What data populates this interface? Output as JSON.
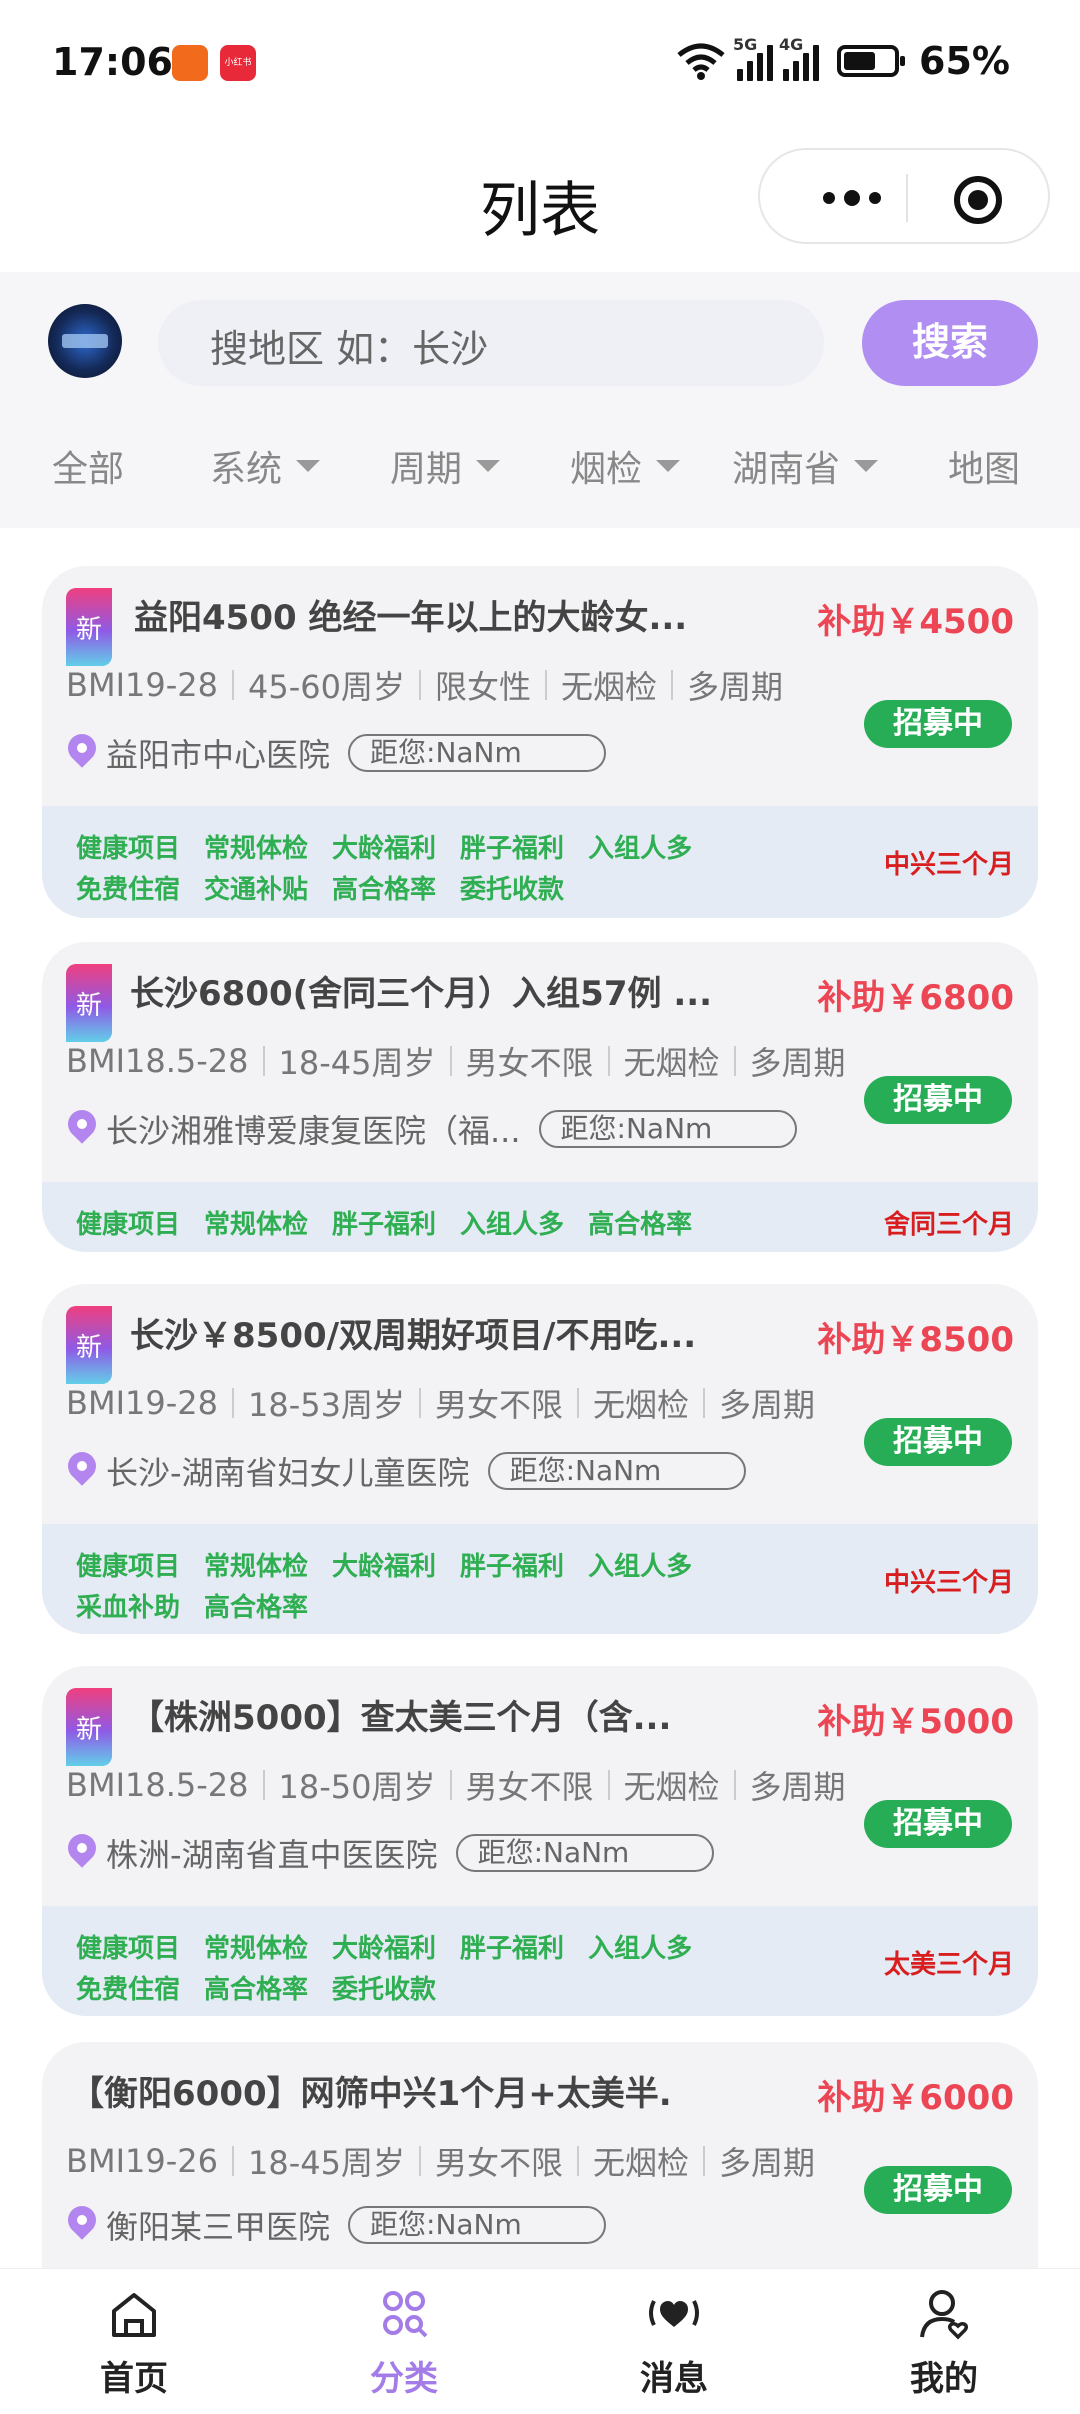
{
  "status": {
    "time": "17:06",
    "battery": "65%",
    "battery_level": 0.65,
    "sig1": "5G",
    "sig2": "4G",
    "mini_app": "小红书"
  },
  "nav": {
    "title": "列表"
  },
  "search": {
    "placeholder": "搜地区 如：长沙",
    "button": "搜索"
  },
  "tabs": [
    {
      "label": "全部"
    },
    {
      "label": "系统"
    },
    {
      "label": "周期"
    },
    {
      "label": "烟检"
    },
    {
      "label": "湖南省"
    },
    {
      "label": "地图"
    }
  ],
  "cards": [
    {
      "new": "新",
      "title": "益阳4500 绝经一年以上的大龄女...",
      "subsidy": "补助￥4500",
      "meta": [
        "BMI19-28",
        "45-60周岁",
        "限女性",
        "无烟检",
        "多周期"
      ],
      "status": "招募中",
      "location": "益阳市中心医院",
      "distance": "距您:NaNm",
      "tags": [
        "健康项目",
        "常规体检",
        "大龄福利",
        "胖子福利",
        "入组人多",
        "免费住宿",
        "交通补贴",
        "高合格率",
        "委托收款"
      ],
      "right_tag": "中兴三个月"
    },
    {
      "new": "新",
      "title": "长沙6800(舍同三个月）入组57例 ...",
      "subsidy": "补助￥6800",
      "meta": [
        "BMI18.5-28",
        "18-45周岁",
        "男女不限",
        "无烟检",
        "多周期"
      ],
      "status": "招募中",
      "location": "长沙湘雅博爱康复医院（福...",
      "distance": "距您:NaNm",
      "tags": [
        "健康项目",
        "常规体检",
        "胖子福利",
        "入组人多",
        "高合格率"
      ],
      "right_tag": "舍同三个月"
    },
    {
      "new": "新",
      "title": "长沙￥8500/双周期好项目/不用吃...",
      "subsidy": "补助￥8500",
      "meta": [
        "BMI19-28",
        "18-53周岁",
        "男女不限",
        "无烟检",
        "多周期"
      ],
      "status": "招募中",
      "location": "长沙-湖南省妇女儿童医院",
      "distance": "距您:NaNm",
      "tags": [
        "健康项目",
        "常规体检",
        "大龄福利",
        "胖子福利",
        "入组人多",
        "采血补助",
        "高合格率"
      ],
      "right_tag": "中兴三个月"
    },
    {
      "new": "新",
      "title": "【株洲5000】查太美三个月（含...",
      "subsidy": "补助￥5000",
      "meta": [
        "BMI18.5-28",
        "18-50周岁",
        "男女不限",
        "无烟检",
        "多周期"
      ],
      "status": "招募中",
      "location": "株洲-湖南省直中医医院",
      "distance": "距您:NaNm",
      "tags": [
        "健康项目",
        "常规体检",
        "大龄福利",
        "胖子福利",
        "入组人多",
        "免费住宿",
        "高合格率",
        "委托收款"
      ],
      "right_tag": "太美三个月"
    },
    {
      "title": "【衡阳6000】网筛中兴1个月+太美半...",
      "subsidy": "补助￥6000",
      "meta": [
        "BMI19-26",
        "18-45周岁",
        "男女不限",
        "无烟检",
        "多周期"
      ],
      "status": "招募中",
      "location": "衡阳某三甲医院",
      "distance": "距您:NaNm"
    }
  ],
  "tabbar": [
    {
      "label": "首页",
      "icon": "home-icon"
    },
    {
      "label": "分类",
      "icon": "category-icon",
      "active": true
    },
    {
      "label": "消息",
      "icon": "message-icon"
    },
    {
      "label": "我的",
      "icon": "profile-icon"
    }
  ]
}
